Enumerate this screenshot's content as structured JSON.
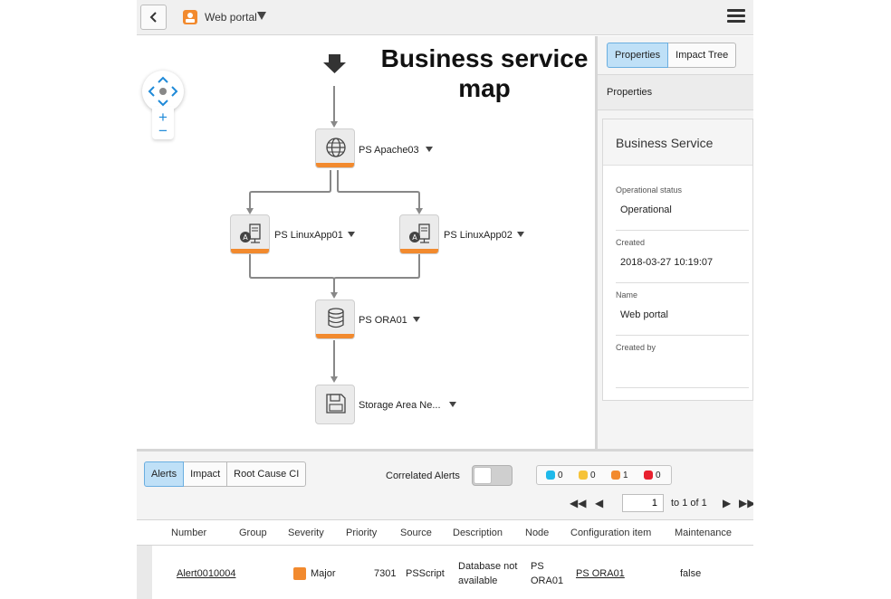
{
  "header": {
    "title": "Web portal"
  },
  "map": {
    "title": "Business service map",
    "nodes": [
      {
        "label": "PS Apache03",
        "icon": "globe-icon"
      },
      {
        "label": "PS LinuxApp01",
        "icon": "linux-server-icon"
      },
      {
        "label": "PS LinuxApp02",
        "icon": "linux-server-icon"
      },
      {
        "label": "PS ORA01",
        "icon": "database-icon"
      },
      {
        "label": "Storage Area Ne...",
        "icon": "storage-disk-icon"
      }
    ],
    "zoom_in": "+",
    "zoom_out": "−"
  },
  "panel": {
    "tabs": [
      "Properties",
      "Impact Tree"
    ],
    "section": "Properties",
    "card_title": "Business Service",
    "fields": [
      {
        "label": "Operational status",
        "value": "Operational"
      },
      {
        "label": "Created",
        "value": "2018-03-27 10:19:07"
      },
      {
        "label": "Name",
        "value": "Web portal"
      },
      {
        "label": "Created by",
        "value": ""
      }
    ]
  },
  "alerts": {
    "tabs": [
      "Alerts",
      "Impact",
      "Root Cause CI"
    ],
    "correlated_label": "Correlated Alerts",
    "counts": [
      {
        "value": "0",
        "color": "#1fb9ea"
      },
      {
        "value": "0",
        "color": "#f6c339"
      },
      {
        "value": "1",
        "color": "#f28a2e"
      },
      {
        "value": "0",
        "color": "#e8202e"
      }
    ],
    "pager": {
      "page": "1",
      "of_text": "to 1 of 1"
    },
    "columns": [
      "Number",
      "Group",
      "Severity",
      "Priority",
      "Source",
      "Description",
      "Node",
      "Configuration item",
      "Maintenance"
    ],
    "rows": [
      {
        "number": "Alert0010004",
        "group": "",
        "severity": "Major",
        "priority": "7301",
        "source": "PSScript",
        "description_line1": "Database not",
        "description_line2": "available",
        "node_line1": "PS",
        "node_line2": "ORA01",
        "ci": "PS ORA01",
        "maintenance": "false"
      }
    ]
  }
}
